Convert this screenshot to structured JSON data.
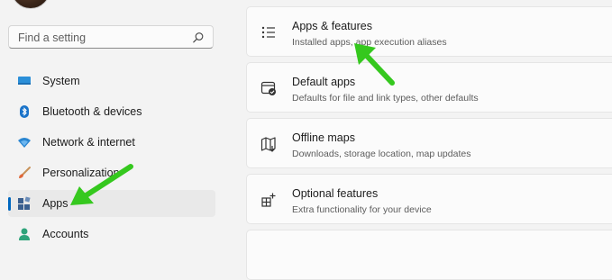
{
  "search": {
    "placeholder": "Find a setting"
  },
  "sidebar": {
    "items": [
      {
        "label": "System"
      },
      {
        "label": "Bluetooth & devices"
      },
      {
        "label": "Network & internet"
      },
      {
        "label": "Personalization"
      },
      {
        "label": "Apps",
        "selected": true
      },
      {
        "label": "Accounts"
      }
    ]
  },
  "cards": [
    {
      "title": "Apps & features",
      "subtitle": "Installed apps, app execution aliases",
      "icon": "list-icon"
    },
    {
      "title": "Default apps",
      "subtitle": "Defaults for file and link types, other defaults",
      "icon": "default-apps-icon"
    },
    {
      "title": "Offline maps",
      "subtitle": "Downloads, storage location, map updates",
      "icon": "map-icon"
    },
    {
      "title": "Optional features",
      "subtitle": "Extra functionality for your device",
      "icon": "optional-features-icon"
    }
  ],
  "colors": {
    "accent": "#0067c0",
    "annotation_arrow": "#35c81e"
  }
}
